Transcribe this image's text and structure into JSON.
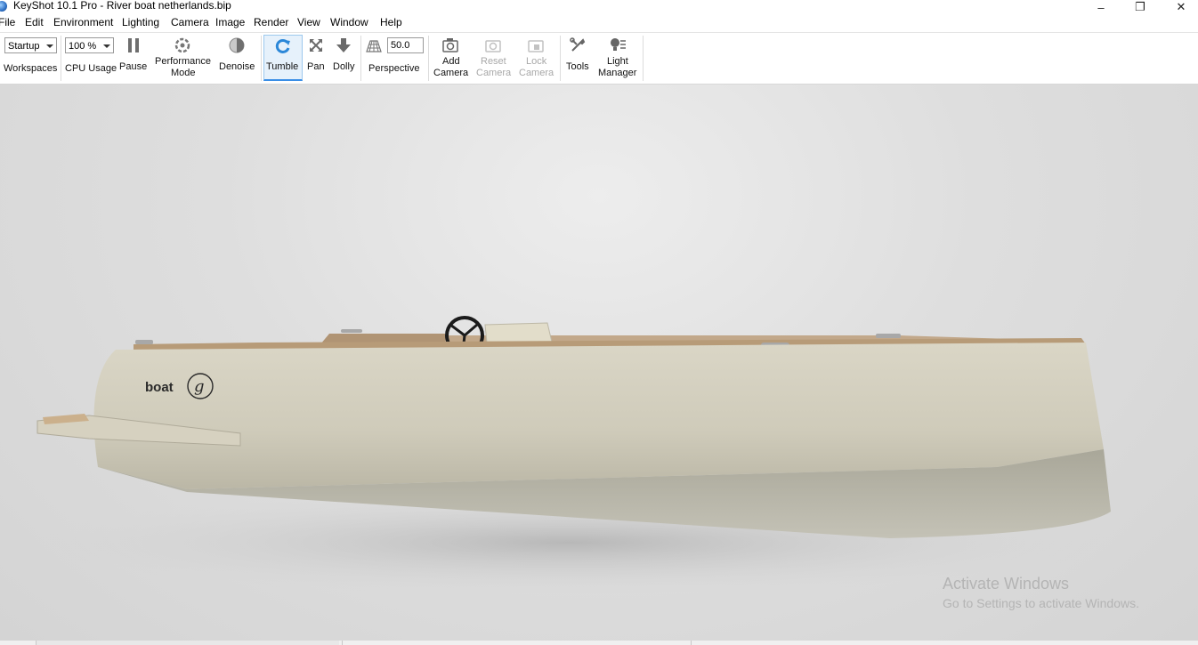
{
  "window": {
    "title": "KeyShot 10.1 Pro  - River boat netherlands.bip",
    "controls": {
      "minimize": "–",
      "maximize": "❐",
      "close": "✕"
    }
  },
  "menu": [
    "File",
    "Edit",
    "Environment",
    "Lighting",
    "Camera",
    "Image",
    "Render",
    "View",
    "Window",
    "Help"
  ],
  "toolbar": {
    "workspace_value": "Startup",
    "workspaces_label": "Workspaces",
    "cpu_value": "100 %",
    "cpu_label": "CPU Usage",
    "pause_label": "Pause",
    "performance_label_1": "Performance",
    "performance_label_2": "Mode",
    "denoise_label": "Denoise",
    "tumble_label": "Tumble",
    "pan_label": "Pan",
    "dolly_label": "Dolly",
    "fov_value": "50.0",
    "perspective_label": "Perspective",
    "add_camera_1": "Add",
    "add_camera_2": "Camera",
    "reset_camera_1": "Reset",
    "reset_camera_2": "Camera",
    "lock_camera_1": "Lock",
    "lock_camera_2": "Camera",
    "tools_label": "Tools",
    "light_manager_1": "Light",
    "light_manager_2": "Manager",
    "active_tool": "Tumble",
    "accent_color": "#2b87d8"
  },
  "viewport": {
    "hull_text": "boat",
    "logo_letter": "g",
    "watermark_title": "Activate Windows",
    "watermark_sub": "Go to Settings to activate Windows."
  }
}
